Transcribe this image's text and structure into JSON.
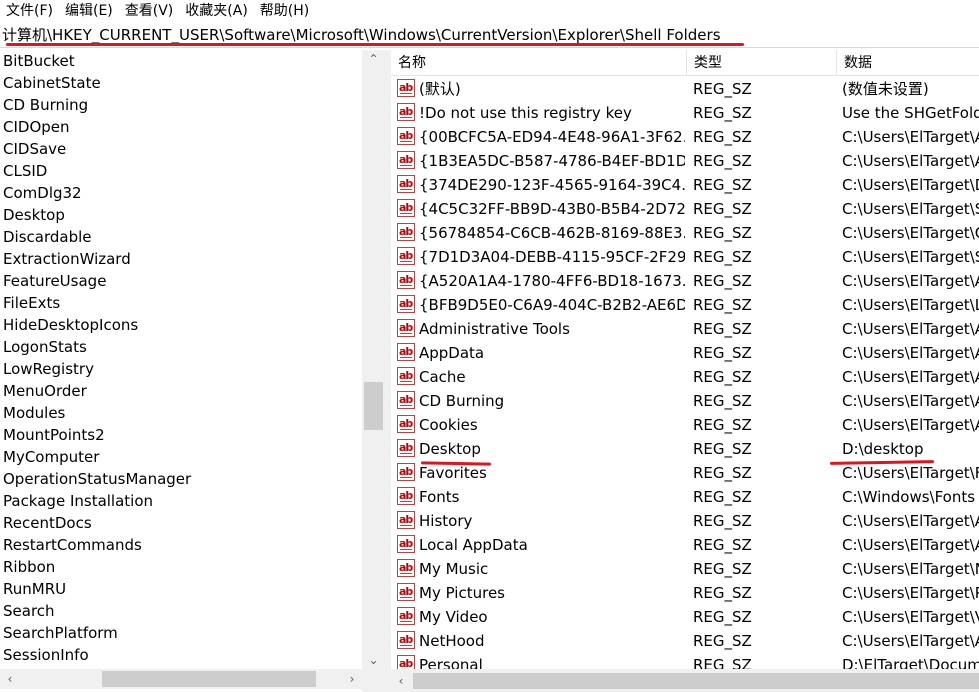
{
  "menu": {
    "file": "文件(F)",
    "edit": "编辑(E)",
    "view": "查看(V)",
    "favorites": "收藏夹(A)",
    "help": "帮助(H)"
  },
  "address": {
    "path": "计算机\\HKEY_CURRENT_USER\\Software\\Microsoft\\Windows\\CurrentVersion\\Explorer\\Shell Folders"
  },
  "tree": {
    "items": [
      "BitBucket",
      "CabinetState",
      "CD Burning",
      "CIDOpen",
      "CIDSave",
      "CLSID",
      "ComDlg32",
      "Desktop",
      "Discardable",
      "ExtractionWizard",
      "FeatureUsage",
      "FileExts",
      "HideDesktopIcons",
      "LogonStats",
      "LowRegistry",
      "MenuOrder",
      "Modules",
      "MountPoints2",
      "MyComputer",
      "OperationStatusManager",
      "Package Installation",
      "RecentDocs",
      "RestartCommands",
      "Ribbon",
      "RunMRU",
      "Search",
      "SearchPlatform",
      "SessionInfo"
    ]
  },
  "list": {
    "columns": {
      "name": "名称",
      "type": "类型",
      "data": "数据"
    },
    "rows": [
      {
        "name": "(默认)",
        "type": "REG_SZ",
        "data": "(数值未设置)"
      },
      {
        "name": "!Do not use this registry key",
        "type": "REG_SZ",
        "data": "Use the SHGetFold"
      },
      {
        "name": "{00BCFC5A-ED94-4E48-96A1-3F62...",
        "type": "REG_SZ",
        "data": "C:\\Users\\ElTarget\\A"
      },
      {
        "name": "{1B3EA5DC-B587-4786-B4EF-BD1D...",
        "type": "REG_SZ",
        "data": "C:\\Users\\ElTarget\\A"
      },
      {
        "name": "{374DE290-123F-4565-9164-39C4...",
        "type": "REG_SZ",
        "data": "C:\\Users\\ElTarget\\D"
      },
      {
        "name": "{4C5C32FF-BB9D-43B0-B5B4-2D72...",
        "type": "REG_SZ",
        "data": "C:\\Users\\ElTarget\\S"
      },
      {
        "name": "{56784854-C6CB-462B-8169-88E3...",
        "type": "REG_SZ",
        "data": "C:\\Users\\ElTarget\\C"
      },
      {
        "name": "{7D1D3A04-DEBB-4115-95CF-2F29...",
        "type": "REG_SZ",
        "data": "C:\\Users\\ElTarget\\S"
      },
      {
        "name": "{A520A1A4-1780-4FF6-BD18-1673...",
        "type": "REG_SZ",
        "data": "C:\\Users\\ElTarget\\A"
      },
      {
        "name": "{BFB9D5E0-C6A9-404C-B2B2-AE6D...",
        "type": "REG_SZ",
        "data": "C:\\Users\\ElTarget\\L"
      },
      {
        "name": "Administrative Tools",
        "type": "REG_SZ",
        "data": "C:\\Users\\ElTarget\\A"
      },
      {
        "name": "AppData",
        "type": "REG_SZ",
        "data": "C:\\Users\\ElTarget\\A"
      },
      {
        "name": "Cache",
        "type": "REG_SZ",
        "data": "C:\\Users\\ElTarget\\A"
      },
      {
        "name": "CD Burning",
        "type": "REG_SZ",
        "data": "C:\\Users\\ElTarget\\A"
      },
      {
        "name": "Cookies",
        "type": "REG_SZ",
        "data": "C:\\Users\\ElTarget\\A"
      },
      {
        "name": "Desktop",
        "type": "REG_SZ",
        "data": "D:\\desktop"
      },
      {
        "name": "Favorites",
        "type": "REG_SZ",
        "data": "C:\\Users\\ElTarget\\F"
      },
      {
        "name": "Fonts",
        "type": "REG_SZ",
        "data": "C:\\Windows\\Fonts"
      },
      {
        "name": "History",
        "type": "REG_SZ",
        "data": "C:\\Users\\ElTarget\\A"
      },
      {
        "name": "Local AppData",
        "type": "REG_SZ",
        "data": "C:\\Users\\ElTarget\\A"
      },
      {
        "name": "My Music",
        "type": "REG_SZ",
        "data": "C:\\Users\\ElTarget\\M"
      },
      {
        "name": "My Pictures",
        "type": "REG_SZ",
        "data": "C:\\Users\\ElTarget\\P"
      },
      {
        "name": "My Video",
        "type": "REG_SZ",
        "data": "C:\\Users\\ElTarget\\V"
      },
      {
        "name": "NetHood",
        "type": "REG_SZ",
        "data": "C:\\Users\\ElTarget\\A"
      },
      {
        "name": "Personal",
        "type": "REG_SZ",
        "data": "D:\\ElTarget\\Docum"
      }
    ]
  },
  "colors": {
    "annotation": "#e0141c",
    "icon_red": "#c00000",
    "scroll_bg": "#f0f0f0",
    "scroll_thumb": "#cdcdcd"
  },
  "icons": {
    "value_icon": "string-value-ab-icon"
  }
}
